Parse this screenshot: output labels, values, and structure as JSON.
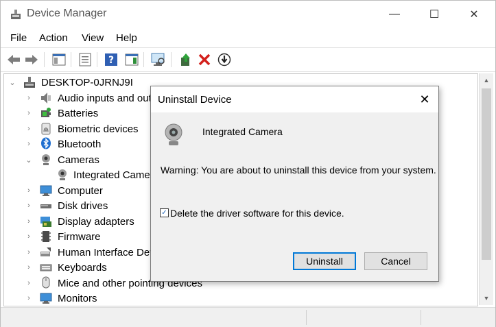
{
  "window": {
    "title": "Device Manager",
    "controls": {
      "minimize": "—",
      "maximize": "☐",
      "close": "✕"
    }
  },
  "menu": [
    "File",
    "Action",
    "View",
    "Help"
  ],
  "tree": {
    "root": "DESKTOP-0JRNJ9I",
    "items": [
      {
        "label": "Audio inputs and outputs",
        "icon": "speaker-icon",
        "expanded": false
      },
      {
        "label": "Batteries",
        "icon": "battery-icon",
        "expanded": false
      },
      {
        "label": "Biometric devices",
        "icon": "fingerprint-icon",
        "expanded": false
      },
      {
        "label": "Bluetooth",
        "icon": "bluetooth-icon",
        "expanded": false
      },
      {
        "label": "Cameras",
        "icon": "camera-icon",
        "expanded": true
      },
      {
        "label": "Integrated Camera",
        "icon": "webcam-icon",
        "child": true
      },
      {
        "label": "Computer",
        "icon": "monitor-icon",
        "expanded": false
      },
      {
        "label": "Disk drives",
        "icon": "disk-icon",
        "expanded": false
      },
      {
        "label": "Display adapters",
        "icon": "display-adapter-icon",
        "expanded": false
      },
      {
        "label": "Firmware",
        "icon": "firmware-icon",
        "expanded": false
      },
      {
        "label": "Human Interface Devices",
        "icon": "hid-icon",
        "expanded": false
      },
      {
        "label": "Keyboards",
        "icon": "keyboard-icon",
        "expanded": false
      },
      {
        "label": "Mice and other pointing devices",
        "icon": "mouse-icon",
        "expanded": false
      },
      {
        "label": "Monitors",
        "icon": "monitor-icon",
        "expanded": false
      }
    ]
  },
  "dialog": {
    "title": "Uninstall Device",
    "device_name": "Integrated Camera",
    "warning": "Warning: You are about to uninstall this device from your system.",
    "checkbox_label": "Delete the driver software for this device.",
    "checkbox_checked": true,
    "uninstall_label": "Uninstall",
    "cancel_label": "Cancel"
  },
  "colors": {
    "accent": "#0078d7",
    "dialog_bg": "#f0f0f0",
    "delete_red": "#d3201c"
  }
}
